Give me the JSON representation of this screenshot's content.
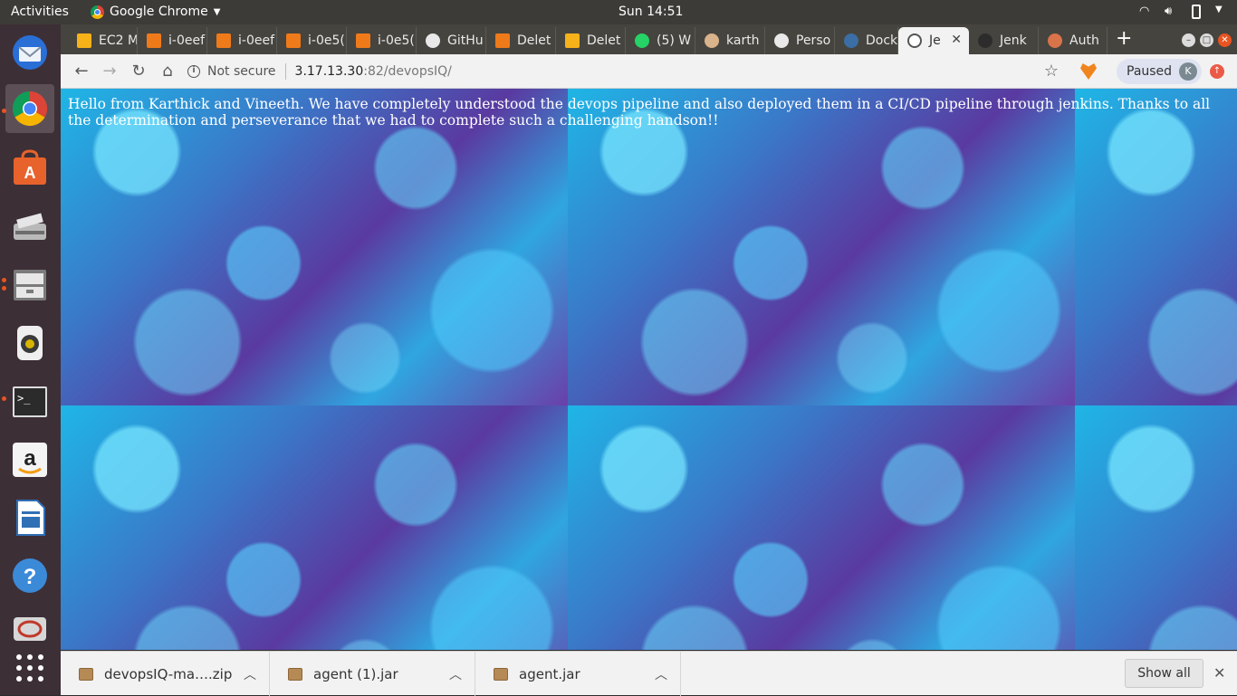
{
  "topbar": {
    "activities": "Activities",
    "app_name": "Google Chrome",
    "clock": "Sun 14:51"
  },
  "tabs": [
    {
      "label": "EC2 M",
      "icon": "aws-cube-icon",
      "color": "#f7b21a"
    },
    {
      "label": "i-0eef",
      "icon": "aws-cube-icon",
      "color": "#ef7a1a"
    },
    {
      "label": "i-0eef",
      "icon": "aws-cube-icon",
      "color": "#ef7a1a"
    },
    {
      "label": "i-0e5(",
      "icon": "aws-cube-icon",
      "color": "#ef7a1a"
    },
    {
      "label": "i-0e5(",
      "icon": "aws-cube-icon",
      "color": "#ef7a1a"
    },
    {
      "label": "GitHu",
      "icon": "github-icon",
      "color": "#e9e9e9"
    },
    {
      "label": "Delet",
      "icon": "aws-cube-icon",
      "color": "#ef7a1a"
    },
    {
      "label": "Delet",
      "icon": "aws-cube-icon",
      "color": "#f7b21a"
    },
    {
      "label": "(5) W",
      "icon": "whatsapp-icon",
      "color": "#25d366"
    },
    {
      "label": "karth",
      "icon": "jenkins-icon",
      "color": "#d9b38c"
    },
    {
      "label": "Perso",
      "icon": "github-icon",
      "color": "#e9e9e9"
    },
    {
      "label": "Dock",
      "icon": "docker-icon",
      "color": "#3b6ea5"
    },
    {
      "label": "Je",
      "icon": "globe-icon",
      "color": "#555555",
      "active": true
    },
    {
      "label": "Jenk",
      "icon": "jenkins-icon",
      "color": "#2c2c2c"
    },
    {
      "label": "Auth",
      "icon": "jenkins-icon",
      "color": "#d9734a"
    }
  ],
  "toolbar": {
    "security_label": "Not secure",
    "url_host": "3.17.13.30",
    "url_rest": ":82/devopsIQ/",
    "paused_label": "Paused",
    "profile_initial": "K"
  },
  "page": {
    "message": "Hello from Karthick and Vineeth. We have completely understood the devops pipeline and also deployed them in a CI/CD pipeline through jenkins. Thanks to all the determination and perseverance that we had to complete such a challenging handson!!"
  },
  "downloads": {
    "items": [
      {
        "name": "devopsIQ-ma….zip"
      },
      {
        "name": "agent (1).jar"
      },
      {
        "name": "agent.jar"
      }
    ],
    "show_all": "Show all"
  },
  "launcher": [
    {
      "name": "thunderbird-icon",
      "running": false
    },
    {
      "name": "chrome-icon",
      "running": true,
      "active": true
    },
    {
      "name": "software-center-icon",
      "running": false
    },
    {
      "name": "scanner-icon",
      "running": false
    },
    {
      "name": "files-icon",
      "running": true
    },
    {
      "name": "rhythmbox-icon",
      "running": false
    },
    {
      "name": "terminal-icon",
      "running": true
    },
    {
      "name": "amazon-icon",
      "running": false
    },
    {
      "name": "writer-icon",
      "running": false
    },
    {
      "name": "help-icon",
      "running": false
    },
    {
      "name": "remote-desktop-icon",
      "running": false
    },
    {
      "name": "app-grid-icon",
      "running": false
    }
  ]
}
